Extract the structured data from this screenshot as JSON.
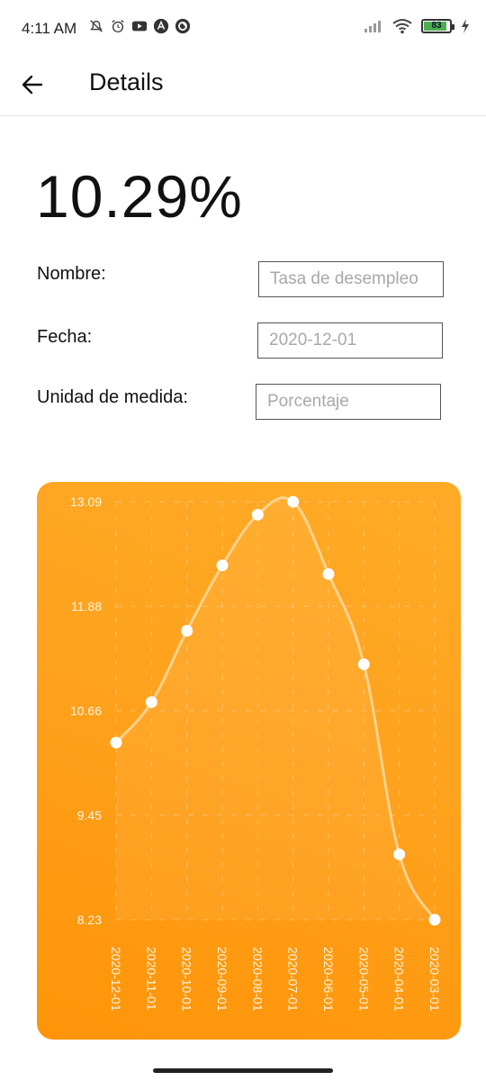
{
  "status_bar": {
    "time": "4:11 AM",
    "left_icons": [
      "mute-alarm-icon",
      "alarm-clock-icon",
      "youtube-icon",
      "app-a-icon",
      "app-circle-icon"
    ],
    "right_icons": [
      "signal-icon",
      "wifi-icon",
      "battery-icon",
      "charging-icon"
    ],
    "battery_level": "83"
  },
  "app_bar": {
    "title": "Details",
    "back_icon": "arrow-left-icon"
  },
  "main": {
    "value": "10.29%",
    "fields": [
      {
        "label": "Nombre:",
        "placeholder": "Tasa de desempleo"
      },
      {
        "label": "Fecha:",
        "placeholder": "2020-12-01"
      },
      {
        "label": "Unidad de medida:",
        "placeholder": "Porcentaje"
      }
    ]
  },
  "colors": {
    "chart_gradient_top": "#ffab27",
    "chart_gradient_bottom": "#ff9408",
    "point": "#ffffff"
  },
  "chart_data": {
    "type": "line",
    "title": "",
    "xlabel": "",
    "ylabel": "",
    "categories": [
      "2020-12-01",
      "2020-11-01",
      "2020-10-01",
      "2020-09-01",
      "2020-08-01",
      "2020-07-01",
      "2020-06-01",
      "2020-05-01",
      "2020-04-01",
      "2020-03-01"
    ],
    "values": [
      10.29,
      10.76,
      11.59,
      12.35,
      12.94,
      13.09,
      12.25,
      11.2,
      8.99,
      8.23
    ],
    "y_ticks": [
      "13.09",
      "11.88",
      "10.66",
      "9.45",
      "8.23"
    ],
    "ylim": [
      8.23,
      13.09
    ],
    "grid": true,
    "curve": "smooth"
  }
}
